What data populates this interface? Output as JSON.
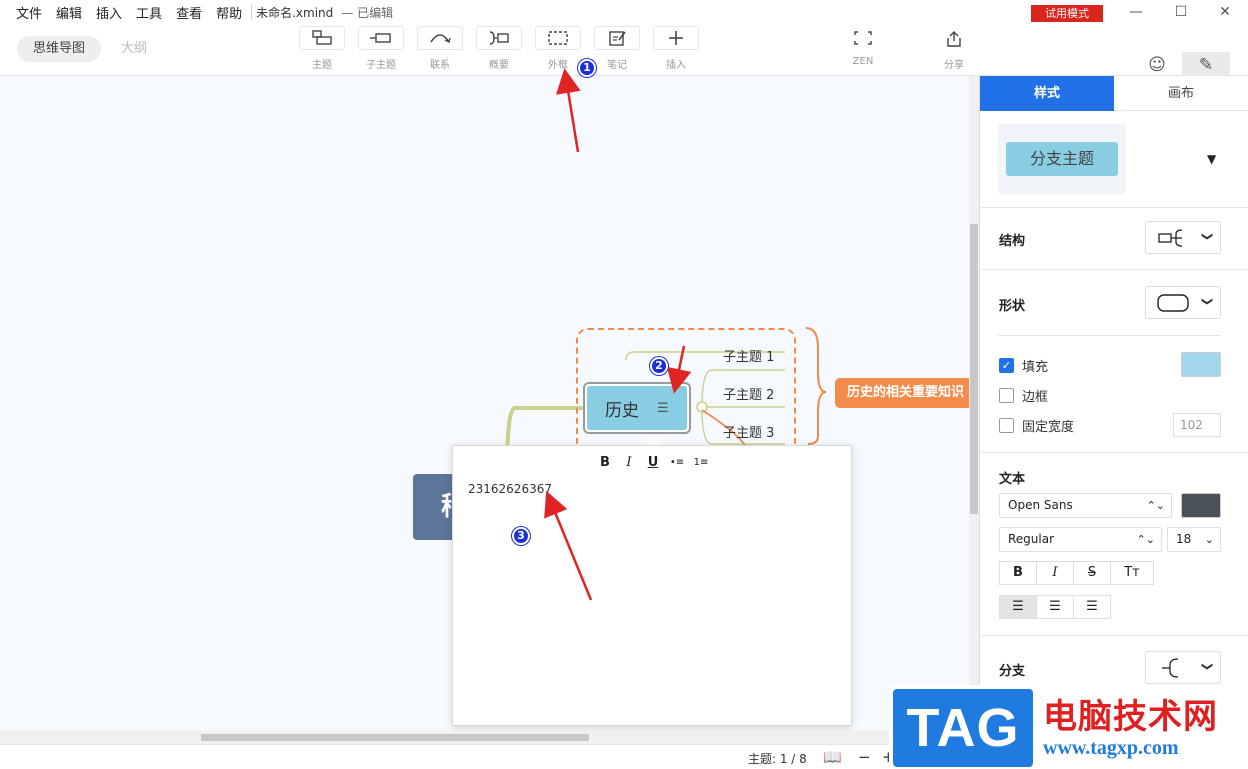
{
  "menu": {
    "items": [
      "文件",
      "编辑",
      "插入",
      "工具",
      "查看",
      "帮助"
    ],
    "filename": "未命名.xmind",
    "status": "— 已编辑",
    "trial_badge": "试用模式"
  },
  "window_controls": {
    "minimize": "—",
    "maximize": "☐",
    "close": "✕"
  },
  "toolbar": {
    "view_tabs": [
      "思维导图",
      "大纲"
    ],
    "tools": [
      {
        "label": "主题",
        "icon": "topic-icon"
      },
      {
        "label": "子主题",
        "icon": "subtopic-icon"
      },
      {
        "label": "联系",
        "icon": "relationship-icon"
      },
      {
        "label": "概要",
        "icon": "summary-icon"
      },
      {
        "label": "外框",
        "icon": "boundary-icon"
      },
      {
        "label": "笔记",
        "icon": "note-icon"
      },
      {
        "label": "插入",
        "icon": "plus-icon"
      },
      {
        "label": "ZEN",
        "icon": "zen-icon"
      },
      {
        "label": "分享",
        "icon": "share-icon"
      }
    ],
    "side_tools": [
      {
        "label": "图标",
        "icon": "smiley-icon"
      },
      {
        "label": "格式",
        "icon": "format-brush-icon"
      }
    ]
  },
  "canvas": {
    "central_topic": "稍",
    "topic": "历史",
    "subtopics": [
      "子主题 1",
      "子主题 2",
      "子主题 3"
    ],
    "summary": "历史的相关重要知识"
  },
  "notes": {
    "format_buttons": [
      "B",
      "I",
      "U",
      "•≡",
      "1≡"
    ],
    "content": "23162626367"
  },
  "markers": [
    "1",
    "2",
    "3"
  ],
  "statusbar": {
    "topic_count": "主题: 1 / 8",
    "zoom_out": "−",
    "zoom_in": "+"
  },
  "panel": {
    "tabs": [
      "样式",
      "画布"
    ],
    "style_preview": "分支主题",
    "structure_label": "结构",
    "shape_label": "形状",
    "fill_label": "填充",
    "fill_checked": true,
    "fill_color": "#a4d6ec",
    "border_label": "边框",
    "border_checked": false,
    "fixed_width_label": "固定宽度",
    "fixed_width_checked": false,
    "fixed_width_value": "102",
    "text_label": "文本",
    "font_family": "Open Sans",
    "font_weight": "Regular",
    "font_size": "18",
    "text_color": "#4a5158",
    "style_buttons": [
      "B",
      "I",
      "S",
      "Tт"
    ],
    "branch_label": "分支"
  },
  "watermark": {
    "logo": "TAG",
    "title": "电脑技术网",
    "url": "www.tagxp.com"
  }
}
